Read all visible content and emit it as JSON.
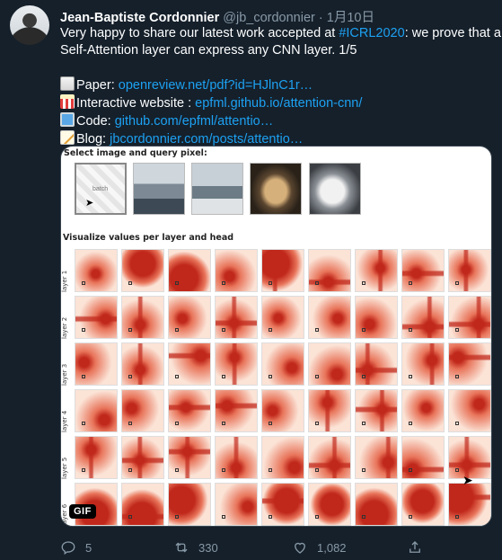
{
  "tweet": {
    "name": "Jean-Baptiste Cordonnier",
    "handle": "@jb_cordonnier",
    "separator": "·",
    "date": "1月10日",
    "text_line1_pre": "Very happy to share our latest work accepted at ",
    "hashtag": "#ICRL2020",
    "text_line1_post": ": we prove that a",
    "text_line2": "Self-Attention layer can express any CNN layer. 1/5",
    "links": [
      {
        "label": "Paper: ",
        "url": "openreview.net/pdf?id=HJlnC1r…",
        "icon": "page-emoji-icon"
      },
      {
        "label": "Interactive website : ",
        "url": "epfml.github.io/attention-cnn/",
        "icon": "popcorn-emoji-icon"
      },
      {
        "label": "Code: ",
        "url": "github.com/epfml/attentio…",
        "icon": "computer-emoji-icon"
      },
      {
        "label": "Blog: ",
        "url": "jbcordonnier.com/posts/attentio…",
        "icon": "memo-emoji-icon"
      }
    ]
  },
  "media": {
    "select_label": "Select image and query pixel:",
    "batch_label": "batch",
    "visualize_label": "Visualize values per layer and head",
    "row_labels": [
      "layer 1",
      "layer 2",
      "layer 3",
      "layer 4",
      "layer 5",
      "layer 6"
    ],
    "badge": "GIF"
  },
  "actions": {
    "replies": "5",
    "retweets": "330",
    "likes": "1,082"
  },
  "colors": {
    "background": "#15202b",
    "link": "#1da1f2",
    "muted": "#8899a6",
    "heat_strong": "#c0281b",
    "heat_mid": "#e8745a",
    "heat_light": "#fbe3d6"
  }
}
